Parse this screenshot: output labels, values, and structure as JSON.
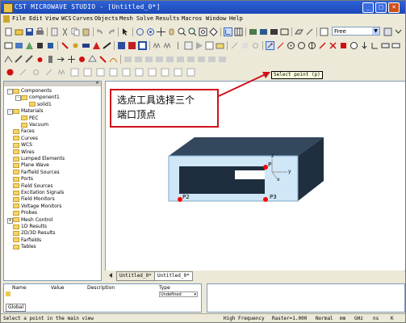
{
  "window": {
    "title": "CST MICROWAVE STUDIO - [Untitled_0*]"
  },
  "menu": [
    "File",
    "Edit",
    "View",
    "WCS",
    "Curves",
    "Objects",
    "Mesh",
    "Solve",
    "Results",
    "Macros",
    "Window",
    "Help"
  ],
  "toolbar": {
    "frame_combo": "Free"
  },
  "tooltip": "Select point (p)",
  "annotation": {
    "line1": "选点工具选择三个",
    "line2": "端口顶点"
  },
  "tree": {
    "items": [
      {
        "label": "Components",
        "indent": 0,
        "exp": "-"
      },
      {
        "label": "component1",
        "indent": 1,
        "exp": "-"
      },
      {
        "label": "solid1",
        "indent": 2,
        "exp": ""
      },
      {
        "label": "Materials",
        "indent": 0,
        "exp": "-"
      },
      {
        "label": "PEC",
        "indent": 1,
        "exp": ""
      },
      {
        "label": "Vacuum",
        "indent": 1,
        "exp": ""
      },
      {
        "label": "Faces",
        "indent": 0,
        "exp": ""
      },
      {
        "label": "Curves",
        "indent": 0,
        "exp": ""
      },
      {
        "label": "WCS",
        "indent": 0,
        "exp": ""
      },
      {
        "label": "Wires",
        "indent": 0,
        "exp": ""
      },
      {
        "label": "Lumped Elements",
        "indent": 0,
        "exp": ""
      },
      {
        "label": "Plane Wave",
        "indent": 0,
        "exp": ""
      },
      {
        "label": "Farfield Sources",
        "indent": 0,
        "exp": ""
      },
      {
        "label": "Ports",
        "indent": 0,
        "exp": ""
      },
      {
        "label": "Field Sources",
        "indent": 0,
        "exp": ""
      },
      {
        "label": "Excitation Signals",
        "indent": 0,
        "exp": ""
      },
      {
        "label": "Field Monitors",
        "indent": 0,
        "exp": ""
      },
      {
        "label": "Voltage Monitors",
        "indent": 0,
        "exp": ""
      },
      {
        "label": "Probes",
        "indent": 0,
        "exp": ""
      },
      {
        "label": "Mesh Control",
        "indent": 0,
        "exp": "+"
      },
      {
        "label": "1D Results",
        "indent": 0,
        "exp": ""
      },
      {
        "label": "2D/3D Results",
        "indent": 0,
        "exp": ""
      },
      {
        "label": "Farfields",
        "indent": 0,
        "exp": ""
      },
      {
        "label": "Tables",
        "indent": 0,
        "exp": ""
      }
    ]
  },
  "view3d": {
    "points": [
      "P",
      "P2",
      "P3"
    ],
    "axes": [
      "z",
      "y",
      "x"
    ]
  },
  "tabs": [
    "Untitled_0*",
    "Untitled_0*"
  ],
  "params": {
    "columns": [
      "Name",
      "Value",
      "Description",
      "Type"
    ],
    "type_value": "Undefined",
    "sheet_tab": "Global"
  },
  "status": {
    "hint": "Select a point in the main view",
    "solver": "High Frequency",
    "raster": "Raster=1.000",
    "mode": "Normal",
    "unit1": "mm",
    "unit2": "GHz",
    "unit3": "ns",
    "unit4": "K"
  },
  "colors": {
    "accent": "#d0101a",
    "title": "#1a47b8",
    "port": "#ff0000",
    "solid": "#2a3e52",
    "wire": "#cfe7f7"
  }
}
